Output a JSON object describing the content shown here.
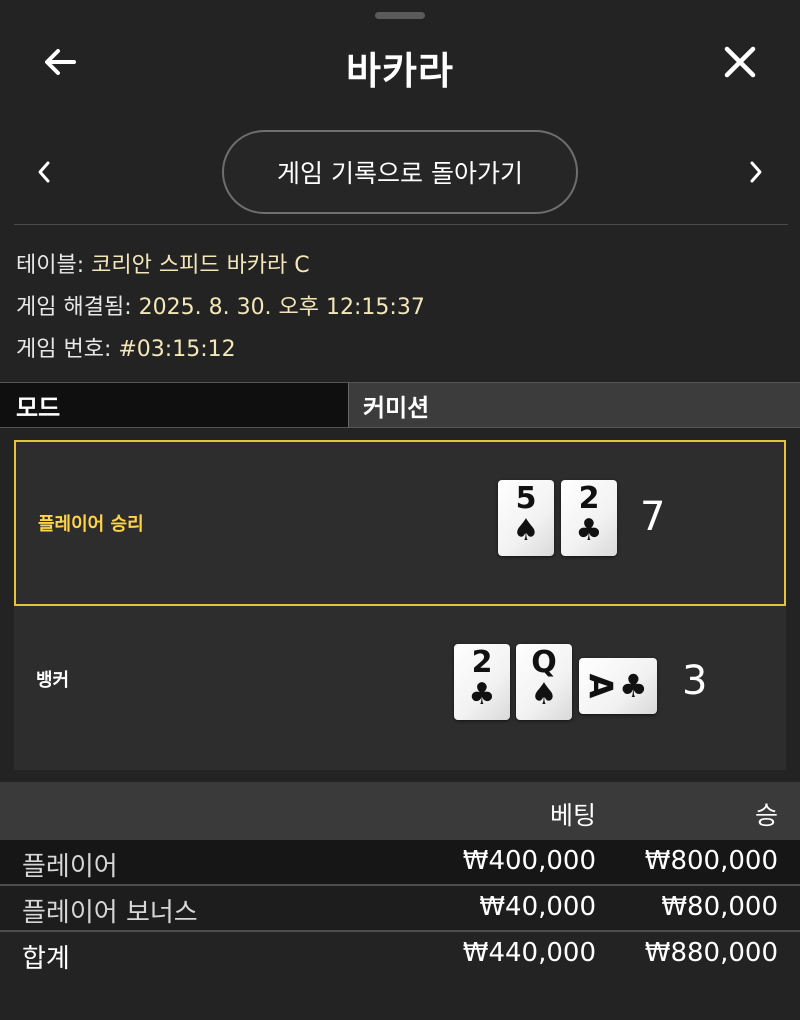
{
  "header": {
    "title": "바카라",
    "back_icon": "arrow-left-icon",
    "close_icon": "close-icon"
  },
  "nav": {
    "history_label": "게임 기록으로 돌아가기"
  },
  "info": {
    "table_label": "테이블:",
    "table_value": "코리안 스피드 바카라 C",
    "resolved_label": "게임 해결됨:",
    "resolved_value": "2025. 8. 30. 오후 12:15:37",
    "number_label": "게임 번호:",
    "number_value": "#03:15:12"
  },
  "mode": {
    "label": "모드",
    "value": "커미션"
  },
  "hands": {
    "player": {
      "label": "플레이어 승리",
      "score": "7",
      "cards": [
        {
          "rank": "5",
          "suit": "♠"
        },
        {
          "rank": "2",
          "suit": "♣"
        }
      ]
    },
    "banker": {
      "label": "뱅커",
      "score": "3",
      "cards": [
        {
          "rank": "2",
          "suit": "♣"
        },
        {
          "rank": "Q",
          "suit": "♠"
        },
        {
          "rank": "A",
          "suit": "♣"
        }
      ]
    }
  },
  "bets": {
    "headers": {
      "bet": "베팅",
      "win": "승"
    },
    "rows": [
      {
        "name": "플레이어",
        "bet": "₩400,000",
        "win": "₩800,000"
      },
      {
        "name": "플레이어 보너스",
        "bet": "₩40,000",
        "win": "₩80,000"
      }
    ],
    "total": {
      "name": "합계",
      "bet": "₩440,000",
      "win": "₩880,000"
    }
  },
  "colors": {
    "accent": "#e6c23a",
    "background": "#232323",
    "info_value": "#f3e6b8"
  }
}
